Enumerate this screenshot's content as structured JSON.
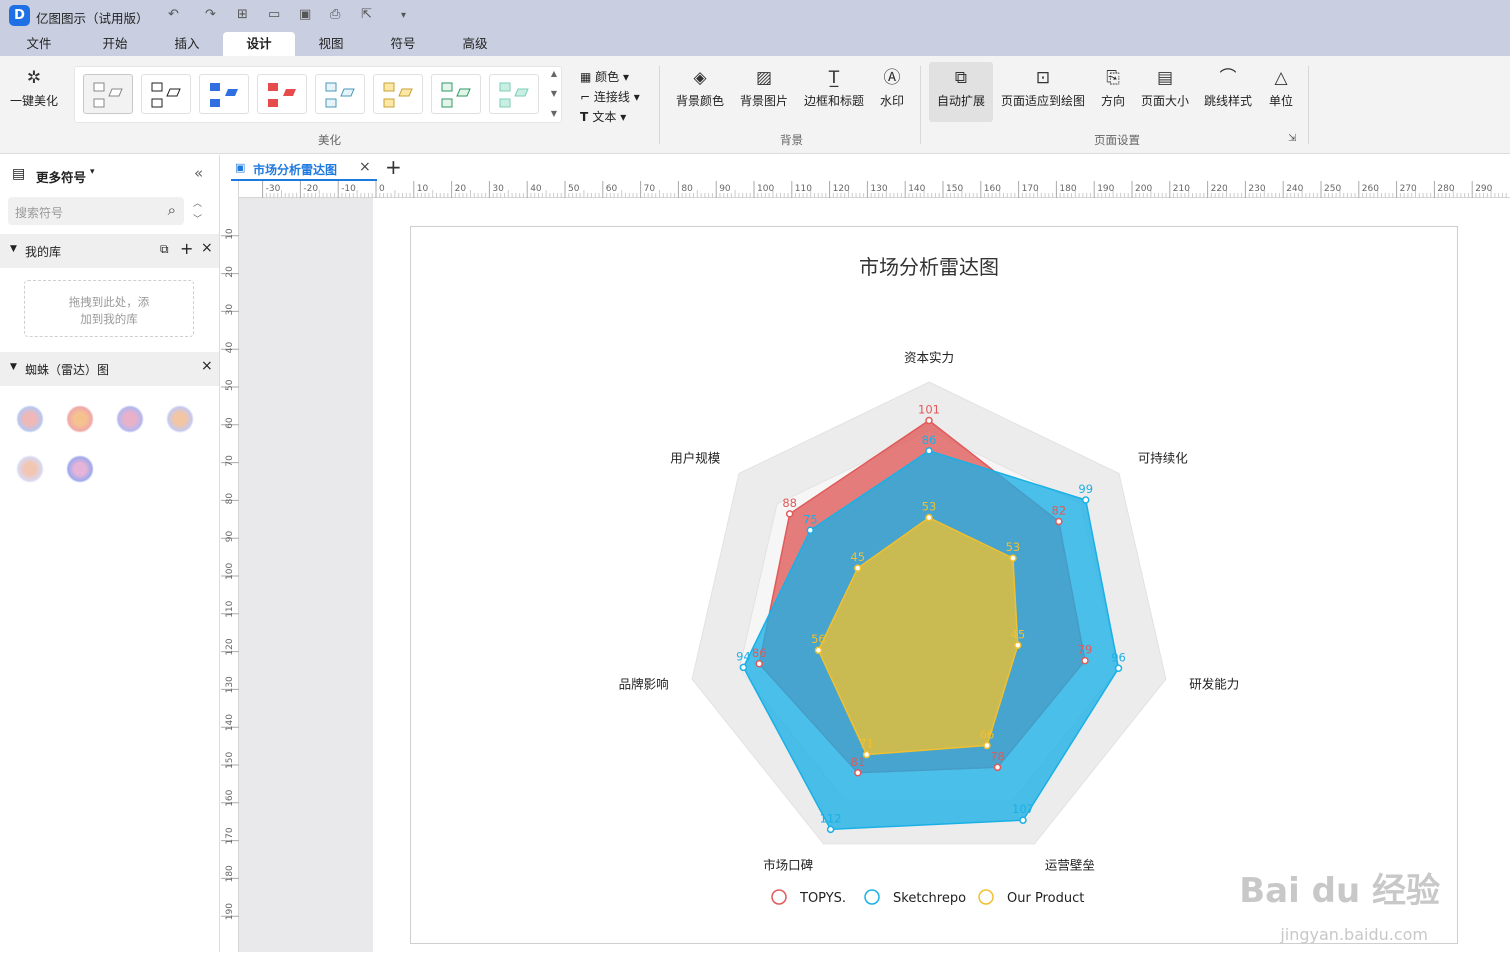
{
  "app": {
    "title": "亿图图示（试用版）",
    "logo": "D"
  },
  "menu": {
    "tabs": [
      "文件",
      "开始",
      "插入",
      "设计",
      "视图",
      "符号",
      "高级"
    ],
    "active": "设计"
  },
  "ribbon": {
    "beautify_btn": "一键美化",
    "small": {
      "color": "颜色",
      "connector": "连接线",
      "text": "文本"
    },
    "group_beautify": "美化",
    "background": {
      "bg_color": "背景颜色",
      "bg_image": "背景图片",
      "border_title": "边框和标题",
      "watermark": "水印",
      "group": "背景"
    },
    "page": {
      "auto_expand": "自动扩展",
      "fit_page": "页面适应到绘图",
      "direction": "方向",
      "page_size": "页面大小",
      "jump_style": "跳线样式",
      "unit": "单位",
      "group": "页面设置"
    }
  },
  "sidebar": {
    "more_symbols": "更多符号",
    "search_placeholder": "搜索符号",
    "my_lib": "我的库",
    "dropzone": [
      "拖拽到此处，添",
      "加到我的库"
    ],
    "spider": "蜘蛛（雷达）图"
  },
  "doc_tab": "市场分析雷达图",
  "ruler_h": [
    "-30",
    "-20",
    "-10",
    "0",
    "10",
    "20",
    "30",
    "40",
    "50",
    "60",
    "70",
    "80",
    "90",
    "100",
    "110",
    "120",
    "130",
    "140",
    "150",
    "160",
    "170",
    "180",
    "190",
    "200",
    "210",
    "220",
    "230",
    "240",
    "250",
    "260",
    "270",
    "280",
    "290"
  ],
  "ruler_v": [
    "10",
    "20",
    "30",
    "40",
    "50",
    "60",
    "70",
    "80",
    "90",
    "100",
    "110",
    "120",
    "130",
    "140",
    "150",
    "160",
    "170",
    "180",
    "190"
  ],
  "watermark": {
    "brand": "Bai du 经验",
    "url": "jingyan.baidu.com"
  },
  "chart_data": {
    "type": "radar",
    "title": "市场分析雷达图",
    "axes": [
      "资本实力",
      "可持续化",
      "研发能力",
      "运营壁垒",
      "市场口碑",
      "品牌影响",
      "用户规模"
    ],
    "max": 120,
    "series": [
      {
        "name": "TOPYS.",
        "color": "#e05a5a",
        "values": [
          101,
          82,
          79,
          78,
          81,
          86,
          88
        ]
      },
      {
        "name": "Sketchrepo",
        "color": "#1ab0e6",
        "values": [
          86,
          99,
          96,
          107,
          112,
          94,
          75
        ]
      },
      {
        "name": "Our Product",
        "color": "#f0c030",
        "values": [
          53,
          53,
          45,
          66,
          71,
          56,
          45
        ]
      }
    ],
    "legend": "bottom",
    "grid": true
  }
}
